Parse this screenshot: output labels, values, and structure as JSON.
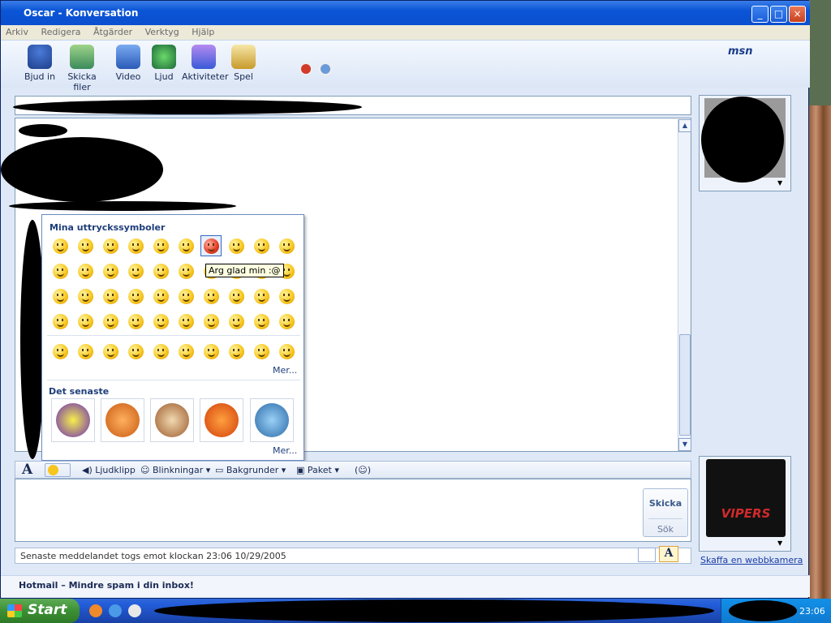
{
  "window": {
    "title": "Oscar - Konversation",
    "buttons": {
      "minimize": "_",
      "maximize": "□",
      "close": "×"
    }
  },
  "menu": [
    "Arkiv",
    "Redigera",
    "Åtgärder",
    "Verktyg",
    "Hjälp"
  ],
  "toolbar": {
    "items": [
      "Bjud in",
      "Skicka filer",
      "Video",
      "Ljud",
      "Aktiviteter",
      "Spel"
    ],
    "logo": "msn"
  },
  "emoticon_panel": {
    "header": "Mina uttryckssymboler",
    "recent_header": "Det senaste",
    "more": "Mer...",
    "tooltip": "Arg glad min :@"
  },
  "format_bar": {
    "font": "A",
    "soundclip": "Ljudklipp",
    "winks": "Blinkningar",
    "backgrounds": "Bakgrunder",
    "packages": "Paket"
  },
  "send": {
    "send_label": "Skicka",
    "search_label": "Sök"
  },
  "status": {
    "last_message": "Senaste meddelandet togs emot klockan 23:06 10/29/2005",
    "font_btn": "A"
  },
  "right_panel": {
    "webcam_link": "Skaffa en webbkamera",
    "avatar_text": "VIPERS"
  },
  "hotmail": "Hotmail – Mindre spam i din inbox!",
  "taskbar": {
    "start": "Start",
    "clock": "23:06"
  }
}
